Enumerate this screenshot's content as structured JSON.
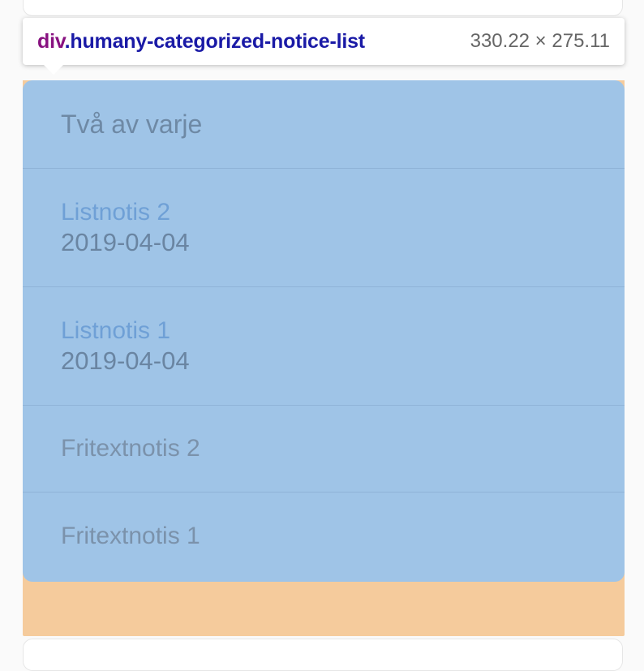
{
  "tooltip": {
    "tag": "div",
    "class_name": ".humany-categorized-notice-list",
    "dimensions": "330.22 × 275.11"
  },
  "notice_list": {
    "header": "Två av varje",
    "items": [
      {
        "title": "Listnotis 2",
        "date": "2019-04-04",
        "kind": "list"
      },
      {
        "title": "Listnotis 1",
        "date": "2019-04-04",
        "kind": "list"
      },
      {
        "title": "Fritextnotis 2",
        "kind": "freetext"
      },
      {
        "title": "Fritextnotis 1",
        "kind": "freetext"
      }
    ]
  },
  "colors": {
    "content_highlight": "#9fc4e7",
    "padding_highlight": "#f5cb9c",
    "tooltip_tag": "#881280",
    "tooltip_class": "#1a1aa6"
  }
}
